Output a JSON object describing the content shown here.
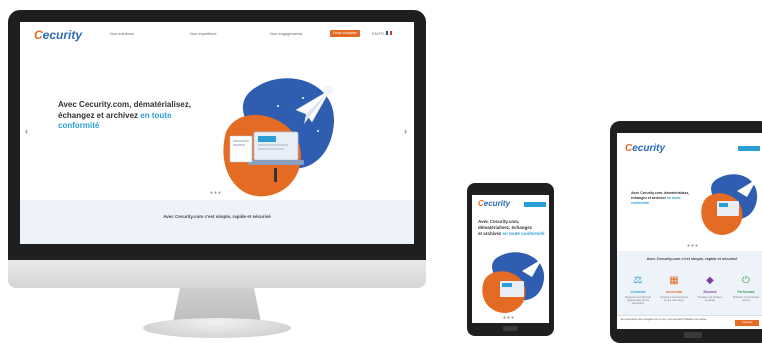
{
  "brand": {
    "logo_text": "Cecurity",
    "accent": "#e36b24",
    "primary": "#2c6bb5",
    "highlight": "#2a9fd6"
  },
  "desktop": {
    "nav": {
      "item1": "Nos solutions",
      "item2": "Nos expertises",
      "item3": "Nos engagements",
      "cta": "Nous contacter",
      "lang": "EN/FR"
    },
    "hero": {
      "line1": "Avec Cecurity.com, dématérialisez,",
      "line2": "échangez et archivez",
      "highlight": "en toute",
      "highlight2": "conformité"
    },
    "band_tagline": "Avec Cecurity.com c'est simple, rapide et sécurisé",
    "prev_arrow": "‹",
    "next_arrow": "›",
    "dots": "●●●"
  },
  "phone": {
    "menu": "MENU",
    "hero": {
      "line1": "Avec Cecurity.com,",
      "line2": "dématérialisez, échangez",
      "line3": "et archivez",
      "highlight": "en toute conformité"
    },
    "dots": "●●●"
  },
  "tablet": {
    "menu": "MENU",
    "hero": {
      "line1": "Avec Cecurity.com, dématérialisez,",
      "line2": "échangez et archivez",
      "highlight": "en toute conformité"
    },
    "band_tagline": "Avec Cecurity.com c'est simple, rapide et sécurisé",
    "features": [
      {
        "icon": "balance-icon",
        "label": "Conforme",
        "color": "#2a9fd6",
        "text": "Respectez la conformité réglementaire de vos documents"
      },
      {
        "icon": "building-icon",
        "label": "Accessible",
        "color": "#e36b24",
        "text": "Accédez à vos documents où que vous soyez"
      },
      {
        "icon": "box-icon",
        "label": "Sécurisé",
        "color": "#7b3fa0",
        "text": "Protégez vos données sensibles"
      },
      {
        "icon": "power-icon",
        "label": "Performant",
        "color": "#3aa65a",
        "text": "Optimisez vos processus métiers"
      }
    ],
    "cookie_text": "En poursuivant votre navigation sur ce site, vous acceptez l'utilisation de cookies.",
    "cookie_button": "J'accepte",
    "dots": "●●●"
  }
}
